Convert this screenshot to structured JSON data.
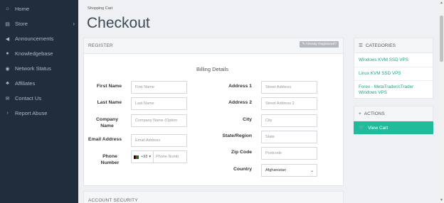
{
  "sidebar": {
    "items": [
      {
        "label": "Home",
        "icon": "home-icon",
        "glyph": "⌂"
      },
      {
        "label": "Store",
        "icon": "store-icon",
        "glyph": "▤"
      },
      {
        "label": "Announcements",
        "icon": "megaphone-icon",
        "glyph": "◀"
      },
      {
        "label": "Knowledgebase",
        "icon": "info-icon",
        "glyph": "●"
      },
      {
        "label": "Network Status",
        "icon": "globe-icon",
        "glyph": "◉"
      },
      {
        "label": "Affiliates",
        "icon": "users-icon",
        "glyph": "♣"
      },
      {
        "label": "Contact Us",
        "icon": "envelope-icon",
        "glyph": "✉"
      },
      {
        "label": "Report Abuse",
        "icon": "chevron-right-icon",
        "glyph": "›"
      }
    ],
    "store_chevron": "›"
  },
  "breadcrumb": "Shopping Cart",
  "page_title": "Checkout",
  "register": {
    "heading": "REGISTER",
    "already_registered": "✎ Already Registered?",
    "billing_title": "Billing Details",
    "fields": {
      "first_name": {
        "label": "First Name",
        "placeholder": "First Name"
      },
      "last_name": {
        "label": "Last Name",
        "placeholder": "Last Name"
      },
      "company": {
        "label": "Company Name",
        "placeholder": "Company Name (Option"
      },
      "email": {
        "label": "Email Address",
        "placeholder": "Email Address"
      },
      "phone": {
        "label": "Phone Number",
        "code": "+93",
        "placeholder": "Phone Numb"
      },
      "address1": {
        "label": "Address 1",
        "placeholder": "Street Address"
      },
      "address2": {
        "label": "Address 2",
        "placeholder": "Street Address 2"
      },
      "city": {
        "label": "City",
        "placeholder": "City"
      },
      "state": {
        "label": "State/Region",
        "placeholder": "State"
      },
      "zip": {
        "label": "Zip Code",
        "placeholder": "Postcode"
      },
      "country": {
        "label": "Country",
        "value": "Afghanistan"
      }
    }
  },
  "account_security": {
    "heading": "ACCOUNT SECURITY"
  },
  "categories": {
    "heading": "CATEGORIES",
    "items": [
      "Windows KVM SSD VPS",
      "Linux KVM SSD VPS",
      "Forex - MetaTrader/cTrader Windows VPS"
    ]
  },
  "actions": {
    "heading": "ACTIONS",
    "view_cart": "View Cart"
  },
  "colors": {
    "sidebar_bg": "#1f2d3d",
    "accent": "#1fbc9c",
    "link": "#17a589"
  }
}
